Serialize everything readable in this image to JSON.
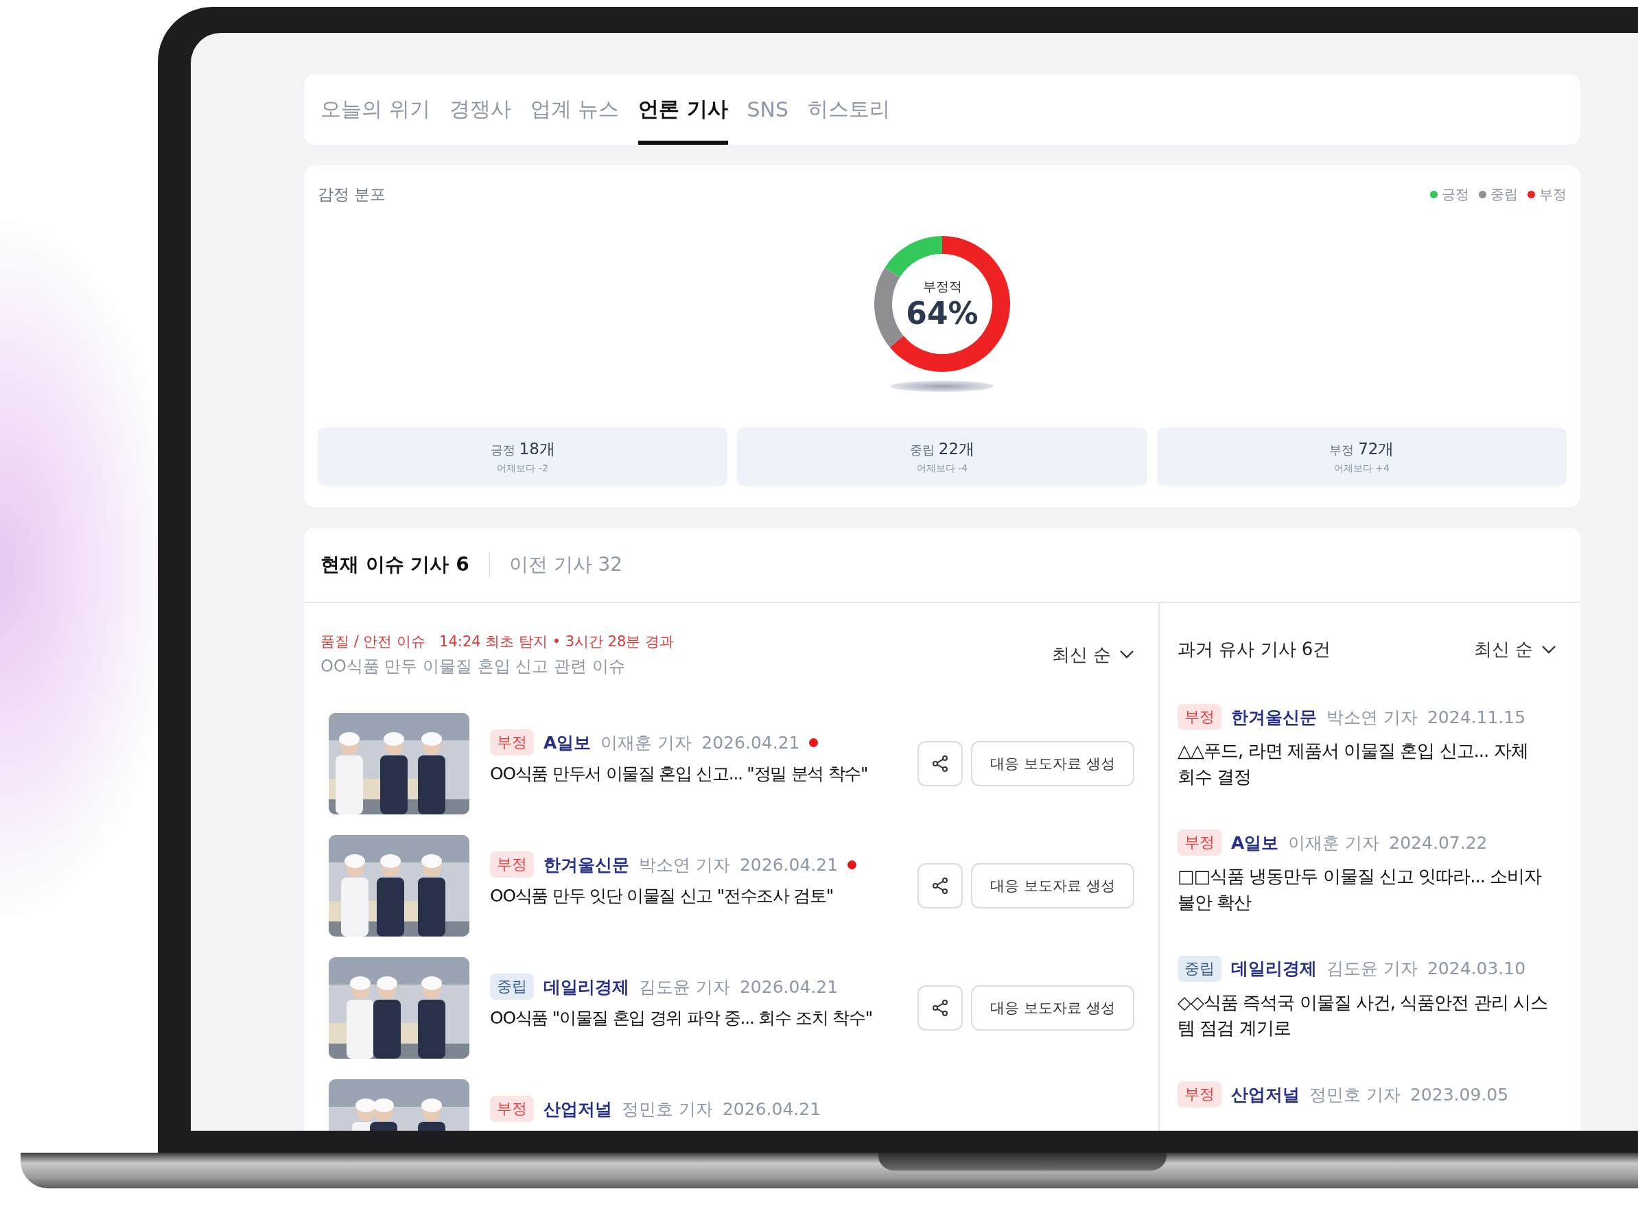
{
  "main_tabs": [
    {
      "label": "오늘의 위기",
      "selected": false
    },
    {
      "label": "경쟁사",
      "selected": false
    },
    {
      "label": "업계 뉴스",
      "selected": false
    },
    {
      "label": "언론 기사",
      "selected": true
    },
    {
      "label": "SNS",
      "selected": false
    },
    {
      "label": "히스토리",
      "selected": false
    }
  ],
  "sentiment": {
    "legend": [
      {
        "color": "#34c759"
      },
      {
        "color": "#8e8e93"
      },
      {
        "color": "#ee2222"
      }
    ],
    "chart_data": {
      "type": "donut",
      "title": "감정 분포",
      "categories": [
        "긍정",
        "중립",
        "부정"
      ],
      "values": [
        16,
        20,
        64
      ]
    },
    "center_label": "부정적",
    "center_value": "64%",
    "stats": [
      {
        "label": "긍정",
        "count": "18개",
        "delta": "어제보다 -2"
      },
      {
        "label": "중립",
        "count": "22개",
        "delta": "어제보다 -4"
      },
      {
        "label": "부정",
        "count": "72개",
        "delta": "어제보다 +4"
      }
    ]
  },
  "article_tabs": [
    {
      "label": "현재 이슈 기사 6",
      "selected": true
    },
    {
      "label": "이전 기사 32",
      "selected": false
    }
  ],
  "issue": {
    "category": "품질 / 안전 이슈",
    "detected": "14:24 최초 탐지 • 3시간 28분 경과",
    "summary": "OO식품 만두 이물질 혼입 신고 관련 이슈",
    "sort": "최신 순"
  },
  "articles": [
    {
      "kind": "negative",
      "tag": "부정",
      "outlet": "A일보",
      "reporter": "이재훈 기자",
      "date": "2026.04.21",
      "new": true,
      "title": "OO식품 만두서 이물질 혼입 신고... \"정밀 분석 착수\"",
      "action": "대응 보도자료 생성"
    },
    {
      "kind": "negative",
      "tag": "부정",
      "outlet": "한겨울신문",
      "reporter": "박소연 기자",
      "date": "2026.04.21",
      "new": true,
      "title": "OO식품 만두 잇단 이물질 신고 \"전수조사 검토\"",
      "action": "대응 보도자료 생성"
    },
    {
      "kind": "neutral",
      "tag": "중립",
      "outlet": "데일리경제",
      "reporter": "김도윤 기자",
      "date": "2026.04.21",
      "new": false,
      "title": "OO식품 \"이물질 혼입 경위 파악 중... 회수 조치 착수\"",
      "action": "대응 보도자료 생성"
    },
    {
      "kind": "negative",
      "tag": "부정",
      "outlet": "산업저널",
      "reporter": "정민호 기자",
      "date": "2026.04.21",
      "new": false
    }
  ],
  "similar": {
    "title": "과거 유사 기사 6건",
    "sort": "최신 순",
    "items": [
      {
        "kind": "negative",
        "tag": "부정",
        "outlet": "한겨울신문",
        "reporter": "박소연 기자",
        "date": "2024.11.15",
        "title": "△△푸드, 라면 제품서 이물질 혼입 신고... 자체 회수 결정"
      },
      {
        "kind": "negative",
        "tag": "부정",
        "outlet": "A일보",
        "reporter": "이재훈 기자",
        "date": "2024.07.22",
        "title": "□□식품 냉동만두 이물질 신고 잇따라... 소비자 불안 확산"
      },
      {
        "kind": "neutral",
        "tag": "중립",
        "outlet": "데일리경제",
        "reporter": "김도윤 기자",
        "date": "2024.03.10",
        "title": "◇◇식품 즉석국 이물질 사건, 식품안전 관리 시스템 점검 계기로"
      },
      {
        "kind": "negative",
        "tag": "부정",
        "outlet": "산업저널",
        "reporter": "정민호 기자",
        "date": "2023.09.05"
      }
    ]
  }
}
